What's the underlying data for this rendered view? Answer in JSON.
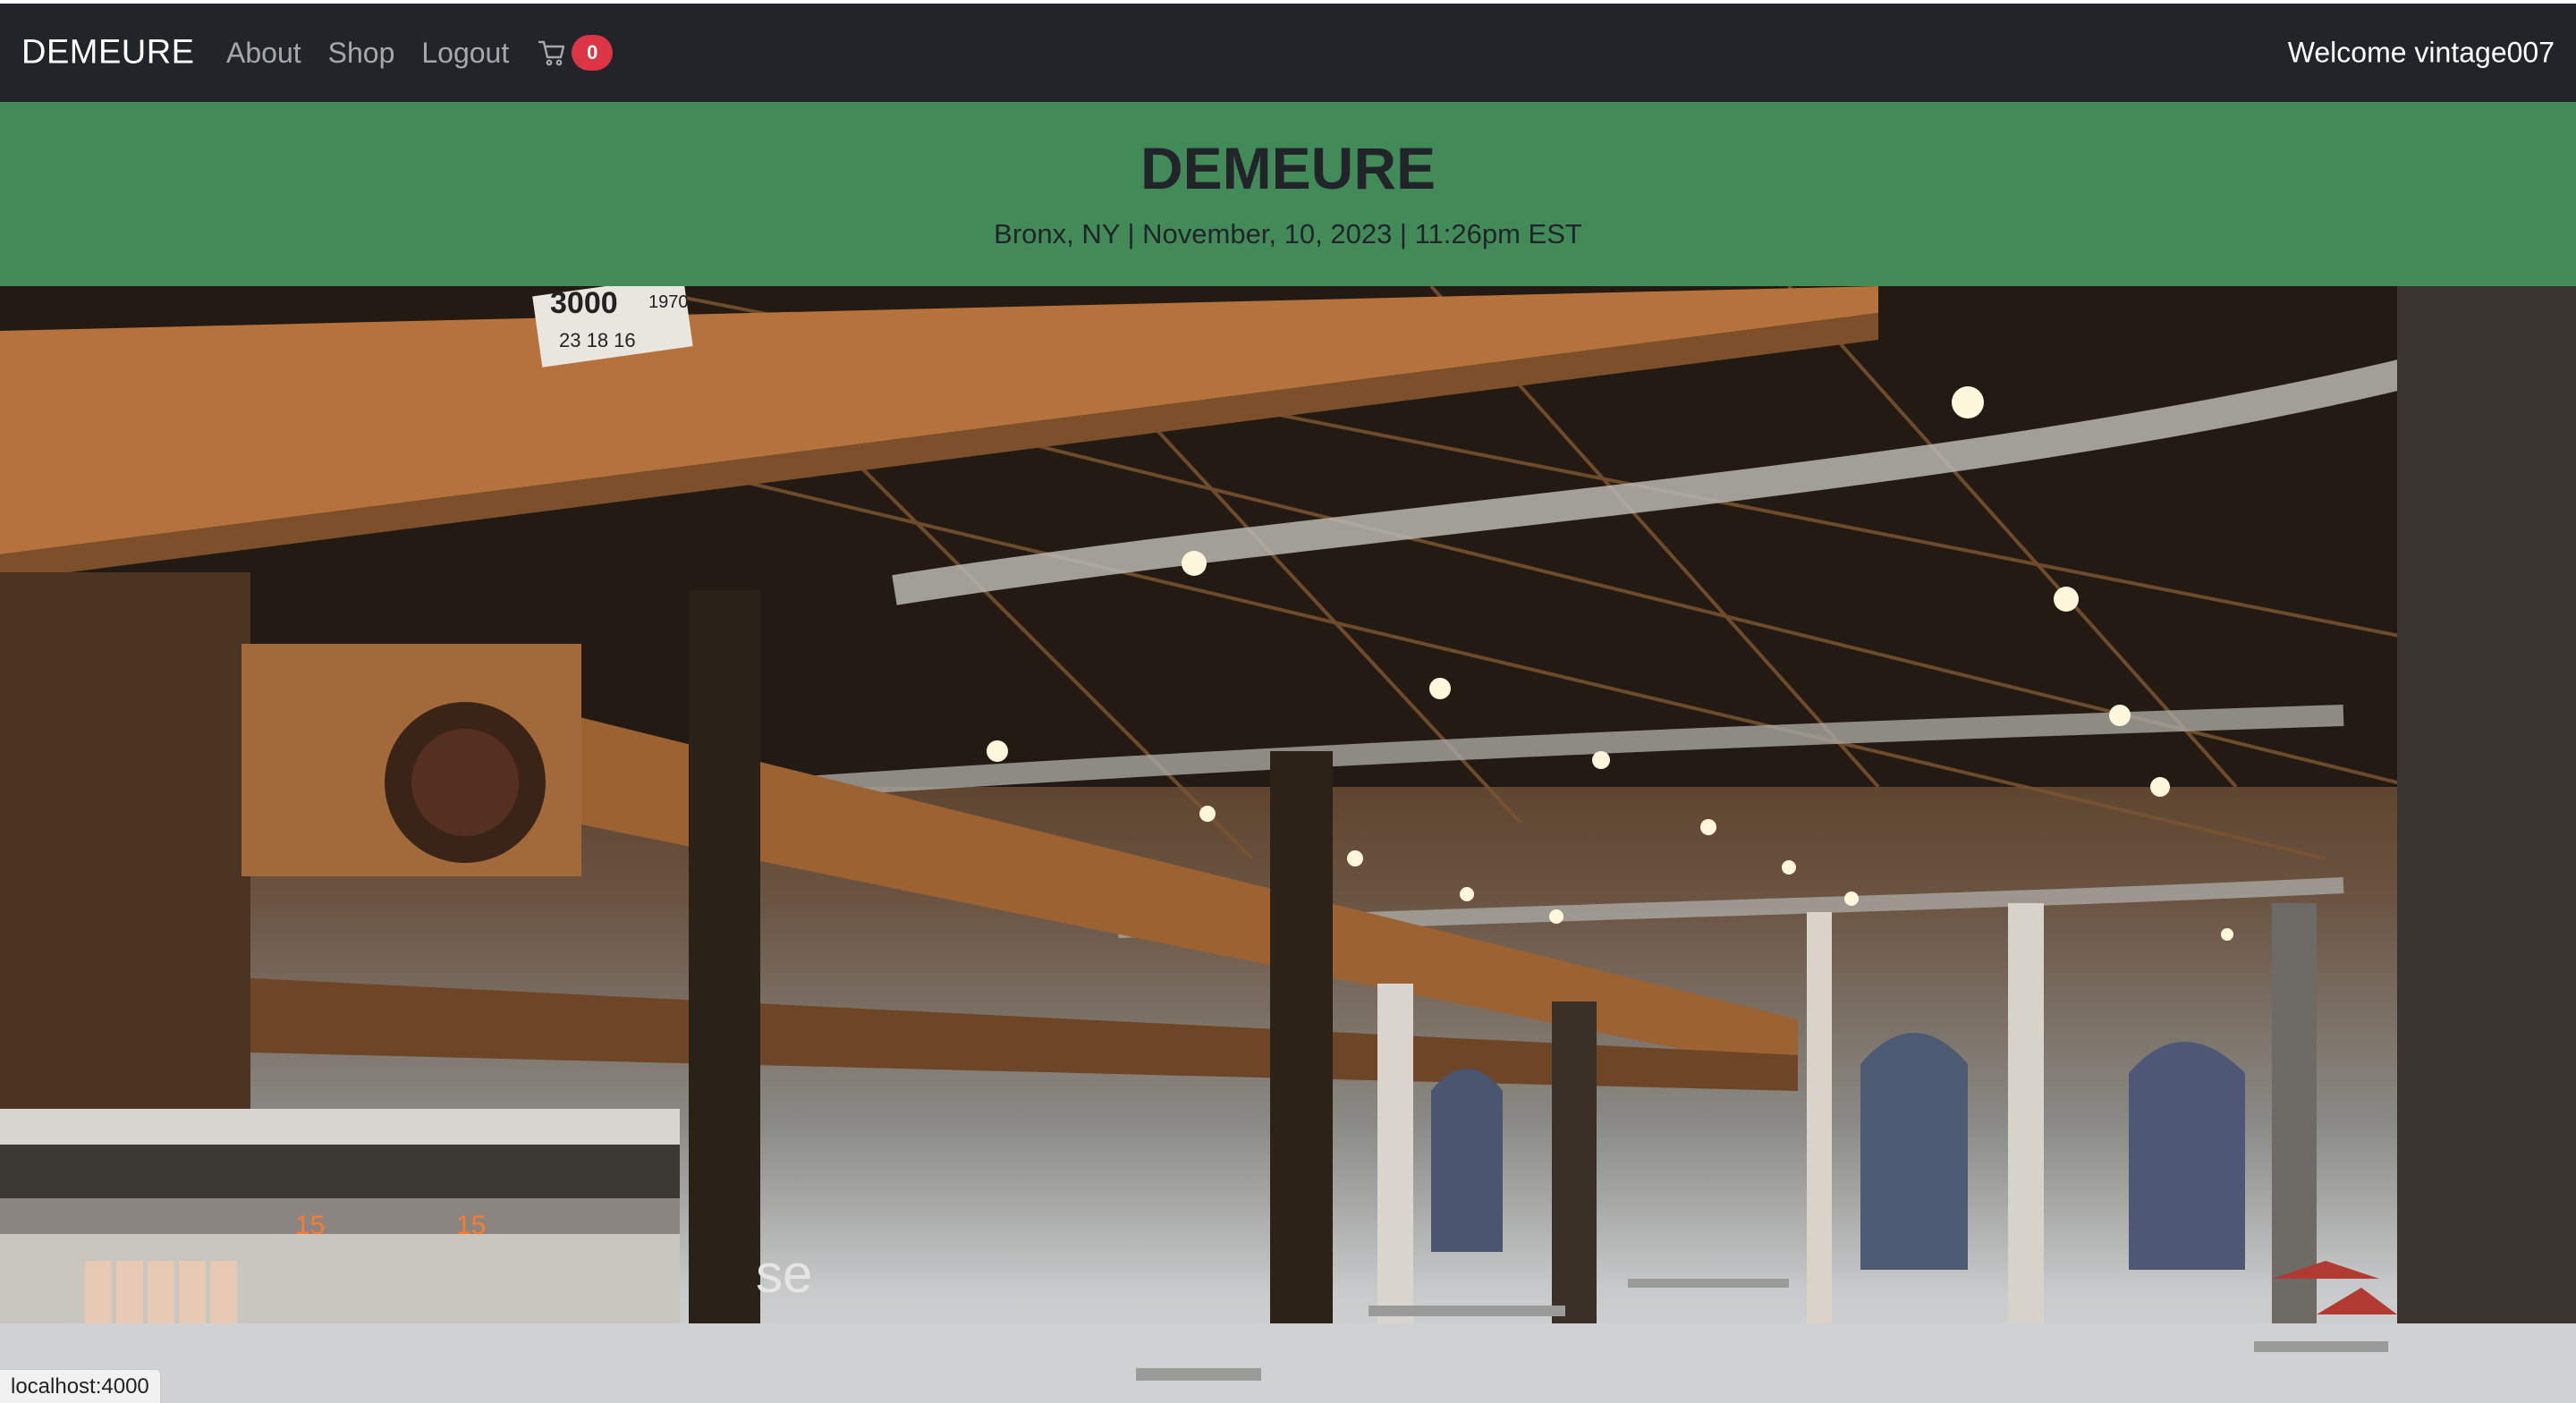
{
  "navbar": {
    "brand": "DEMEURE",
    "links": [
      "About",
      "Shop",
      "Logout"
    ],
    "cart_count": "0",
    "welcome": "Welcome vintage007"
  },
  "banner": {
    "title": "DEMEURE",
    "subtitle": "Bronx, NY | November, 10, 2023 | 11:26pm EST"
  },
  "hero": {
    "signs": [
      "3000",
      "23 18 16",
      "1970",
      "15",
      "15",
      "se"
    ]
  },
  "statusbar": {
    "url": "localhost:4000"
  },
  "colors": {
    "navbar_bg": "#212529",
    "banner_bg": "#438a59",
    "badge_bg": "#dc3545"
  },
  "icons": {
    "cart": "cart-icon"
  }
}
